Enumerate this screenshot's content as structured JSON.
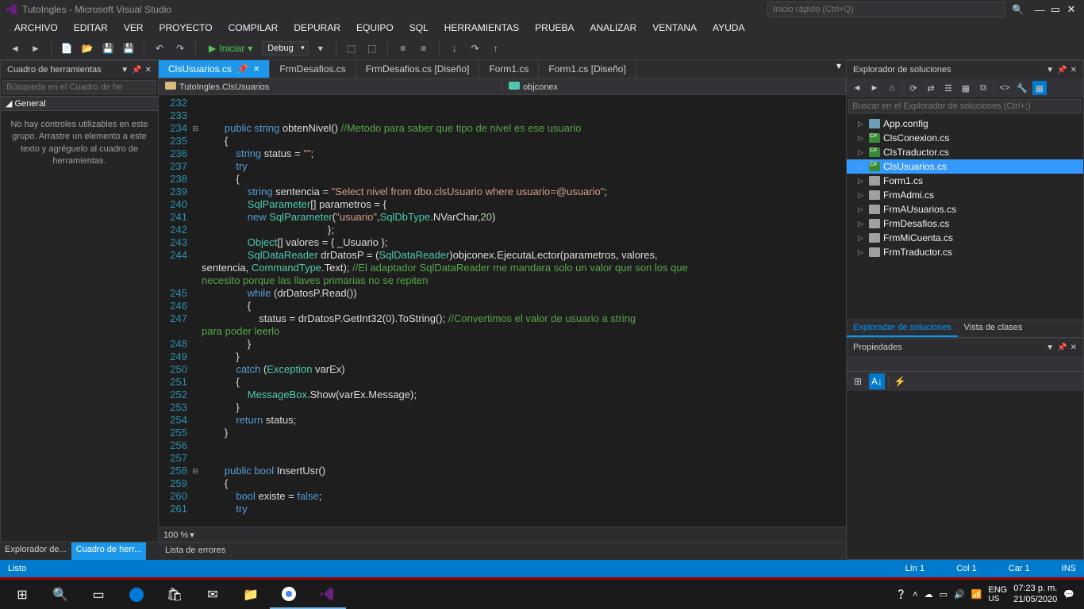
{
  "window": {
    "title": "TutoIngles - Microsoft Visual Studio"
  },
  "quick_launch": {
    "placeholder": "Inicio rápido (Ctrl+Q)"
  },
  "menu": [
    "ARCHIVO",
    "EDITAR",
    "VER",
    "PROYECTO",
    "COMPILAR",
    "DEPURAR",
    "EQUIPO",
    "SQL",
    "HERRAMIENTAS",
    "PRUEBA",
    "ANALIZAR",
    "VENTANA",
    "AYUDA"
  ],
  "start_button": "Iniciar",
  "config": "Debug",
  "toolbox": {
    "title": "Cuadro de herramientas",
    "search_placeholder": "Búsqueda en el Cuadro de he",
    "group": "General",
    "empty_text": "No hay controles utilizables en este grupo. Arrastre un elemento a este texto y agréguelo al cuadro de herramientas."
  },
  "left_bottom_tabs": {
    "inactive": "Explorador de...",
    "active": "Cuadro de herr..."
  },
  "doc_tabs": [
    "ClsUsuarios.cs",
    "FrmDesafios.cs",
    "FrmDesafios.cs [Diseño]",
    "Form1.cs",
    "Form1.cs [Diseño]"
  ],
  "nav": {
    "left": "TutoIngles.ClsUsuarios",
    "right": "objconex"
  },
  "code_lines": [
    {
      "n": 232,
      "t": ""
    },
    {
      "n": 233,
      "t": ""
    },
    {
      "n": 234,
      "t": "        <span class='kw'>public</span> <span class='kw'>string</span> obtenNivel() <span class='cmt'>//Metodo para saber que tipo de nivel es ese usuario</span>",
      "fold": "⊟"
    },
    {
      "n": 235,
      "t": "        {"
    },
    {
      "n": 236,
      "t": "            <span class='kw'>string</span> status = <span class='str'>\"\"</span>;"
    },
    {
      "n": 237,
      "t": "            <span class='kw'>try</span>"
    },
    {
      "n": 238,
      "t": "            {"
    },
    {
      "n": 239,
      "t": "                <span class='kw'>string</span> sentencia = <span class='str'>\"Select nivel from dbo.clsUsuario where usuario=@usuario\"</span>;"
    },
    {
      "n": 240,
      "t": "                <span class='type'>SqlParameter</span>[] parametros = {"
    },
    {
      "n": 241,
      "t": "                <span class='kw'>new</span> <span class='type'>SqlParameter</span>(<span class='str'>\"usuario\"</span>,<span class='type'>SqlDbType</span>.NVarChar,<span class='num'>20</span>)"
    },
    {
      "n": 242,
      "t": "                                            };"
    },
    {
      "n": 243,
      "t": "                <span class='type'>Object</span>[] valores = { _Usuario };"
    },
    {
      "n": 244,
      "t": "                <span class='type'>SqlDataReader</span> drDatosP = (<span class='type'>SqlDataReader</span>)objconex.EjecutaLector(parametros, valores, \nsentencia, <span class='type'>CommandType</span>.Text); <span class='cmt'>//El adaptador SqlDataReader me mandara solo un valor que son los que \nnecesito porque las llaves primarias no se repiten</span>"
    },
    {
      "n": 245,
      "t": "                <span class='kw'>while</span> (drDatosP.Read())"
    },
    {
      "n": 246,
      "t": "                {"
    },
    {
      "n": 247,
      "t": "                    status = drDatosP.GetInt32(<span class='num'>0</span>).ToString(); <span class='cmt'>//Convertimos el valor de usuario a string \npara poder leerlo</span>"
    },
    {
      "n": 248,
      "t": "                }"
    },
    {
      "n": 249,
      "t": "            }"
    },
    {
      "n": 250,
      "t": "            <span class='kw'>catch</span> (<span class='type'>Exception</span> varEx)"
    },
    {
      "n": 251,
      "t": "            {"
    },
    {
      "n": 252,
      "t": "                <span class='type'>MessageBox</span>.Show(varEx.Message);"
    },
    {
      "n": 253,
      "t": "            }"
    },
    {
      "n": 254,
      "t": "            <span class='kw'>return</span> status;"
    },
    {
      "n": 255,
      "t": "        }"
    },
    {
      "n": 256,
      "t": ""
    },
    {
      "n": 257,
      "t": ""
    },
    {
      "n": 258,
      "t": "        <span class='kw'>public</span> <span class='kw'>bool</span> InsertUsr()",
      "fold": "⊟"
    },
    {
      "n": 259,
      "t": "        {"
    },
    {
      "n": 260,
      "t": "            <span class='kw'>bool</span> existe = <span class='kw'>false</span>;"
    },
    {
      "n": 261,
      "t": "            <span class='kw'>try</span>"
    }
  ],
  "zoom": "100 %",
  "sol": {
    "title": "Explorador de soluciones",
    "search_placeholder": "Buscar en el Explorador de soluciones (Ctrl+;)",
    "items": [
      {
        "label": "App.config",
        "icon": "cfg"
      },
      {
        "label": "ClsConexion.cs",
        "icon": "cs"
      },
      {
        "label": "ClsTraductor.cs",
        "icon": "cs"
      },
      {
        "label": "ClsUsuarios.cs",
        "icon": "cs",
        "sel": true
      },
      {
        "label": "Form1.cs",
        "icon": "frm"
      },
      {
        "label": "FrmAdmi.cs",
        "icon": "frm"
      },
      {
        "label": "FrmAUsuarios.cs",
        "icon": "frm"
      },
      {
        "label": "FrmDesafios.cs",
        "icon": "frm"
      },
      {
        "label": "FrmMiCuenta.cs",
        "icon": "frm"
      },
      {
        "label": "FrmTraductor.cs",
        "icon": "frm"
      }
    ],
    "tabs": {
      "active": "Explorador de soluciones",
      "inactive": "Vista de clases"
    }
  },
  "props": {
    "title": "Propiedades"
  },
  "errors": "Lista de errores",
  "status": {
    "ready": "Listo",
    "line": "Lín 1",
    "col": "Col 1",
    "car": "Car 1",
    "ins": "INS"
  },
  "taskbar": {
    "lang": "ENG",
    "kb": "US",
    "time": "07:23 p. m.",
    "date": "21/05/2020"
  }
}
